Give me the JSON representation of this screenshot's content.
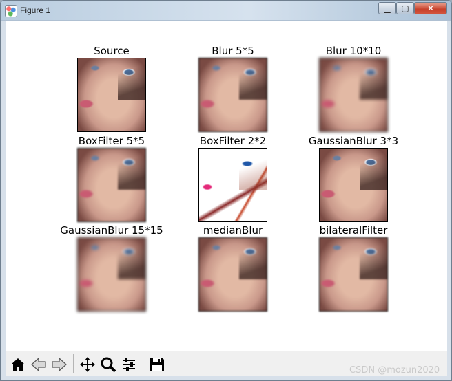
{
  "window": {
    "title": "Figure 1",
    "controls": {
      "minimize": "▁",
      "maximize": "▢",
      "close": "✕"
    }
  },
  "figure": {
    "panels": [
      {
        "title": "Source"
      },
      {
        "title": "Blur 5*5"
      },
      {
        "title": "Blur 10*10"
      },
      {
        "title": "BoxFilter 5*5"
      },
      {
        "title": "BoxFilter 2*2"
      },
      {
        "title": "GaussianBlur 3*3"
      },
      {
        "title": "GaussianBlur 15*15"
      },
      {
        "title": "medianBlur"
      },
      {
        "title": "bilateralFilter"
      }
    ]
  },
  "toolbar": {
    "icons": [
      "home-icon",
      "back-icon",
      "forward-icon",
      "pan-icon",
      "zoom-icon",
      "configure-subplots-icon",
      "save-icon"
    ]
  },
  "watermark": "CSDN @mozun2020"
}
